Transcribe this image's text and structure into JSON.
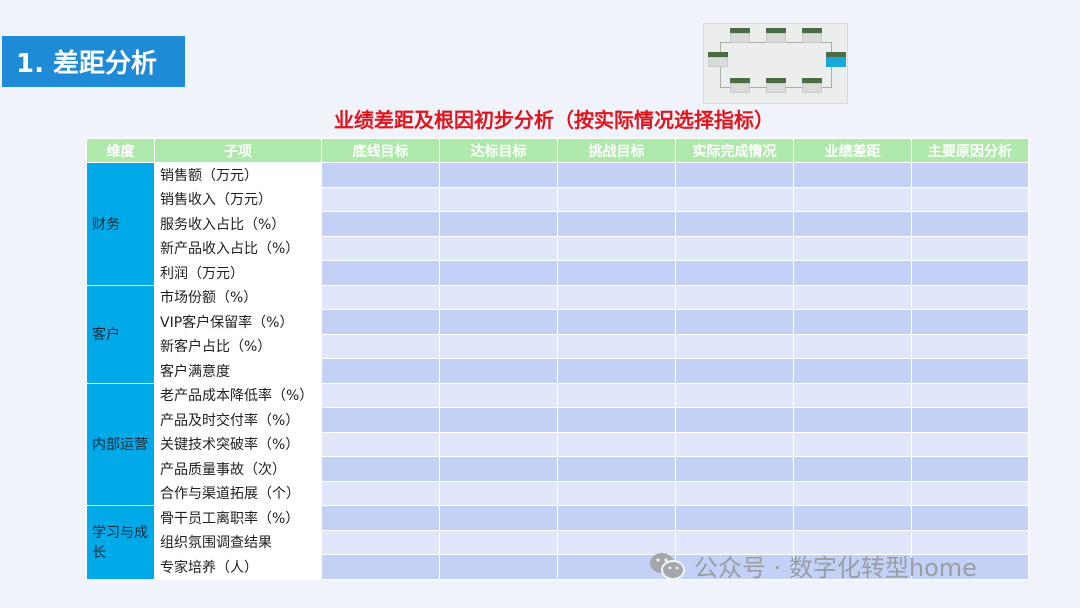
{
  "section_title": "1. 差距分析",
  "subtitle": "业绩差距及根因初步分析（按实际情况选择指标）",
  "table": {
    "headers": [
      "维度",
      "子项",
      "底线目标",
      "达标目标",
      "挑战目标",
      "实际完成情况",
      "业绩差距",
      "主要原因分析"
    ],
    "groups": [
      {
        "dimension": "财务",
        "items": [
          "销售额（万元）",
          "销售收入（万元）",
          "服务收入占比（%）",
          "新产品收入占比（%）",
          "利润（万元）"
        ]
      },
      {
        "dimension": "客户",
        "items": [
          "市场份额（%）",
          "VIP客户保留率（%）",
          "新客户占比（%）",
          "客户满意度"
        ]
      },
      {
        "dimension": "内部运营",
        "items": [
          "老产品成本降低率（%）",
          "产品及时交付率（%）",
          "关键技术突破率（%）",
          "产品质量事故（次）",
          "合作与渠道拓展（个）"
        ]
      },
      {
        "dimension": "学习与成长",
        "items": [
          "骨干员工离职率（%）",
          "组织氛围调查结果",
          "专家培养（人）"
        ]
      }
    ]
  },
  "watermark": "公众号 · 数字化转型home",
  "colors": {
    "title_bg": "#1f8ad6",
    "subtitle": "#e0141d",
    "header_bg": "#aee8aa",
    "dimension_bg": "#00aae9",
    "row_dark": "#c4d1f7",
    "row_light": "#e1e7fb"
  }
}
